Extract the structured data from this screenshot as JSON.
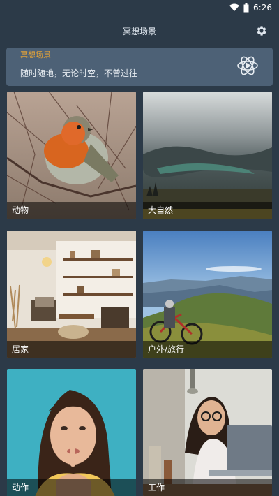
{
  "status_bar": {
    "time": "6:26",
    "icons": [
      "wifi-icon",
      "battery-icon"
    ]
  },
  "app_bar": {
    "title": "冥想场景",
    "settings_icon": "gear-icon"
  },
  "banner": {
    "title": "冥想场景",
    "text": "随时随地，无论时空，不曾过往",
    "icon": "meditation-icon"
  },
  "categories": [
    {
      "label": "动物"
    },
    {
      "label": "大自然"
    },
    {
      "label": "居家"
    },
    {
      "label": "户外/旅行"
    },
    {
      "label": "动作"
    },
    {
      "label": "工作"
    }
  ],
  "colors": {
    "background": "#2c3a48",
    "banner": "#4d6176",
    "accent": "#e0a23a"
  }
}
